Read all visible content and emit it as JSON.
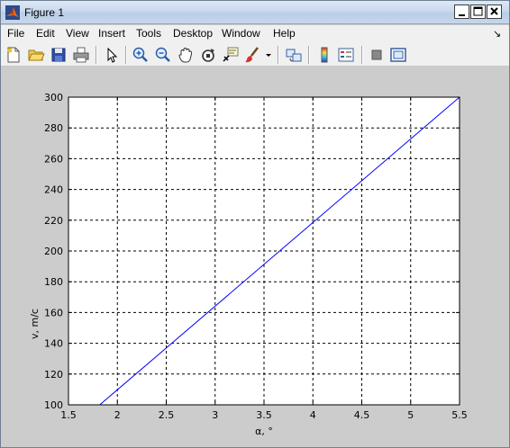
{
  "window": {
    "title": "Figure 1"
  },
  "menu": {
    "items": [
      "File",
      "Edit",
      "View",
      "Insert",
      "Tools",
      "Desktop",
      "Window",
      "Help"
    ],
    "overflow_arrow": "↘"
  },
  "toolbar": {
    "icons": [
      "new-figure-icon",
      "open-file-icon",
      "save-icon",
      "print-icon",
      "pointer-icon",
      "zoom-in-icon",
      "zoom-out-icon",
      "pan-icon",
      "rotate-3d-icon",
      "data-cursor-icon",
      "brush-icon",
      "dropdown-arrow-icon",
      "link-plot-icon",
      "colorbar-icon",
      "legend-icon",
      "hide-plot-tools-icon",
      "show-plot-tools-icon"
    ]
  },
  "chart_data": {
    "type": "line",
    "xlabel": "α, °",
    "ylabel": "v, m/c",
    "xlim": [
      1.5,
      5.5
    ],
    "ylim": [
      100,
      300
    ],
    "xticks": [
      "1.5",
      "2",
      "2.5",
      "3",
      "3.5",
      "4",
      "4.5",
      "5",
      "5.5"
    ],
    "yticks": [
      "100",
      "120",
      "140",
      "160",
      "180",
      "200",
      "220",
      "240",
      "260",
      "280",
      "300"
    ],
    "grid": true,
    "series": [
      {
        "color": "#0000ff",
        "x": [
          1.82,
          5.5
        ],
        "y": [
          100,
          300
        ]
      }
    ]
  }
}
